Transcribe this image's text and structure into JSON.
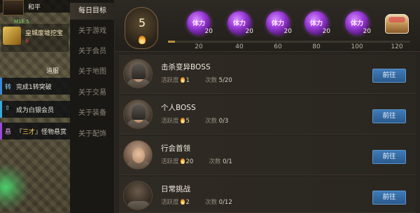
{
  "world": {
    "player_name": "和平",
    "level_text": "M1E 5",
    "quest_title": "皇城废墟挖宝",
    "quest_sub": "6",
    "npc_name": "道服",
    "tasks": [
      {
        "kind": "转",
        "text": "完成1转突破"
      },
      {
        "kind": "",
        "text": "成为白银会员"
      },
      {
        "kind": "悬",
        "text_pre": "『",
        "highlight": "三才",
        "text_post": "』怪物悬赏"
      }
    ]
  },
  "nav": {
    "items": [
      "每日目标",
      "关于游戏",
      "关于会员",
      "关于地图",
      "关于交易",
      "关于装备",
      "关于配饰"
    ],
    "active_index": 0
  },
  "progress": {
    "current_activity": "5",
    "progress_fraction": 0.03,
    "rewards": [
      {
        "label": "体力",
        "count": "20",
        "tick": "20",
        "icon": "stamina-orb-icon"
      },
      {
        "label": "体力",
        "count": "20",
        "tick": "40",
        "icon": "stamina-orb-icon"
      },
      {
        "label": "体力",
        "count": "20",
        "tick": "60",
        "icon": "stamina-orb-icon"
      },
      {
        "label": "体力",
        "count": "20",
        "tick": "80",
        "icon": "stamina-orb-icon"
      },
      {
        "label": "体力",
        "count": "20",
        "tick": "100",
        "icon": "stamina-orb-icon"
      },
      {
        "label": "",
        "count": "",
        "tick": "120",
        "icon": "treasure-chest-icon"
      }
    ]
  },
  "labels": {
    "activity": "活跃度",
    "times": "次数",
    "go": "前往"
  },
  "activities": [
    {
      "name": "击杀变异BOSS",
      "activity": "1",
      "times": "5/20",
      "portrait": "armored-warrior"
    },
    {
      "name": "个人BOSS",
      "activity": "5",
      "times": "0/3",
      "portrait": "armored-warrior"
    },
    {
      "name": "行会首领",
      "activity": "20",
      "times": "0/1",
      "portrait": "bald-elder"
    },
    {
      "name": "日常挑战",
      "activity": "2",
      "times": "0/12",
      "portrait": "dark-figure"
    }
  ],
  "colors": {
    "accent_button": "#2b5a8c",
    "reward_orb": "#9a3ad8",
    "flame": "#f0a020",
    "panel_bg": "#27231e"
  }
}
